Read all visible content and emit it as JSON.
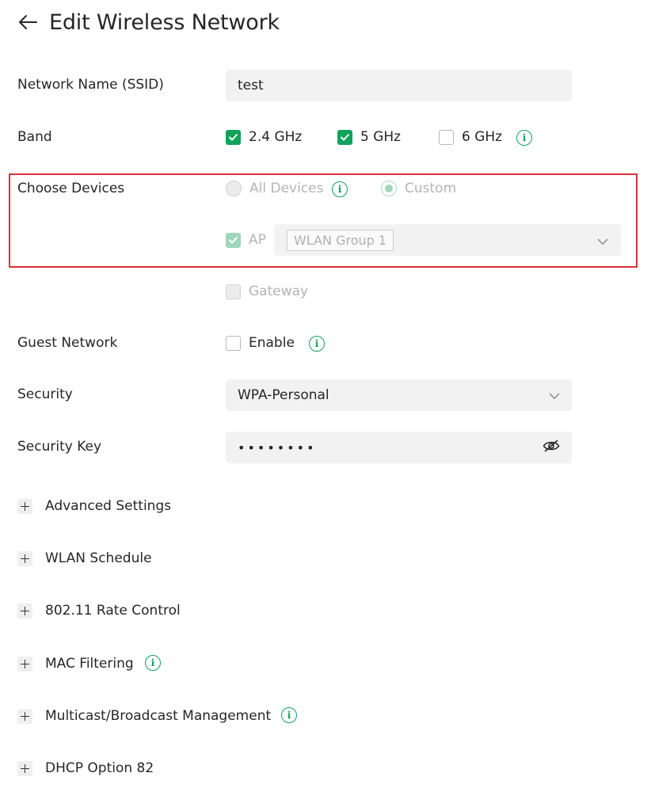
{
  "header": {
    "title": "Edit Wireless Network"
  },
  "fields": {
    "ssid": {
      "label": "Network Name (SSID)",
      "value": "test"
    },
    "band": {
      "label": "Band",
      "options": [
        {
          "label": "2.4 GHz",
          "checked": true
        },
        {
          "label": "5 GHz",
          "checked": true
        },
        {
          "label": "6 GHz",
          "checked": false
        }
      ]
    },
    "devices": {
      "label": "Choose Devices",
      "radio_all": "All Devices",
      "radio_custom": "Custom",
      "selected": "Custom",
      "ap_label": "AP",
      "ap_group": "WLAN Group 1",
      "gateway_label": "Gateway"
    },
    "guest": {
      "label": "Guest Network",
      "option": "Enable",
      "checked": false
    },
    "security": {
      "label": "Security",
      "value": "WPA-Personal"
    },
    "security_key": {
      "label": "Security Key",
      "masked_value": "••••••••"
    }
  },
  "sections": [
    {
      "label": "Advanced Settings",
      "info": false
    },
    {
      "label": "WLAN Schedule",
      "info": false
    },
    {
      "label": "802.11 Rate Control",
      "info": false
    },
    {
      "label": "MAC Filtering",
      "info": true
    },
    {
      "label": "Multicast/Broadcast Management",
      "info": true
    },
    {
      "label": "DHCP Option 82",
      "info": false
    }
  ],
  "colors": {
    "accent": "#11a25b",
    "highlight_border": "#d9313a",
    "field_bg": "#f2f2f2"
  }
}
